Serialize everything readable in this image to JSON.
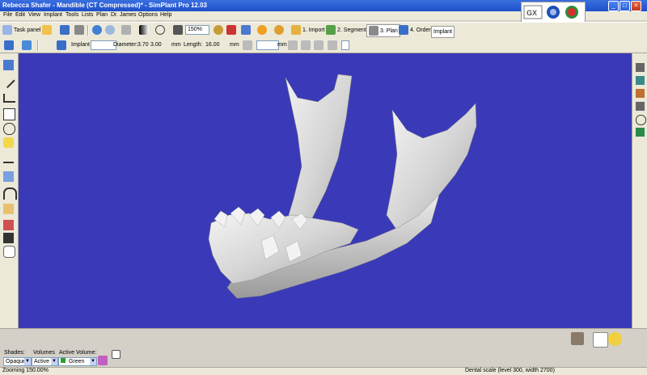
{
  "window": {
    "title": "Rebecca Shafer - Mandible (CT Compressed)* - SimPlant Pro  12.03"
  },
  "menu": [
    "File",
    "Edit",
    "View",
    "Implant",
    "Tools",
    "Lists",
    "Plan",
    "Dr. James",
    "Options",
    "Help"
  ],
  "toolbar": {
    "task_panel": "Task panel",
    "zoom": "150%",
    "steps": [
      "1. Import",
      "2. Segment",
      "3. Plan",
      "4. Order"
    ],
    "implant_tab": "Implant"
  },
  "implant_bar": {
    "implant_label": "Implant",
    "diameter_label": "Diameter:",
    "diameter_value": "3.70",
    "diameter_value2": "3.00",
    "diameter_unit": "mm",
    "length_label": "Length:",
    "length_value": "16.00",
    "length_unit": "mm",
    "unit3": "mm"
  },
  "bottom": {
    "shades_label": "Shades:",
    "volumes_label": "Volumes",
    "active_volume_label": "Active Volume:",
    "shade_value": "Opaque",
    "volume_value": "Active",
    "active_volume_value": "Green"
  },
  "status": {
    "left": "Zooming 150.00%",
    "right": "Dental scale (level 300, width 2700)"
  },
  "colors": {
    "viewport_bg": "#3a3ab8",
    "titlebar": "#2456d6",
    "bone": "#e6e6e6"
  }
}
